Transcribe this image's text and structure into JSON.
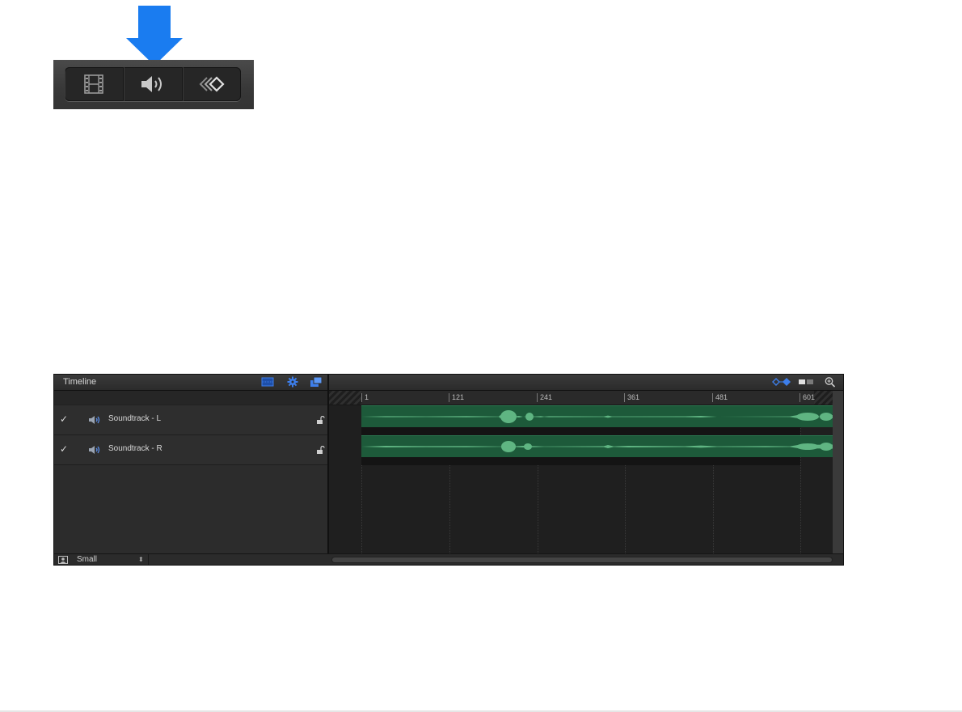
{
  "callout": {
    "arrow_color": "#1a7cf0",
    "segments": [
      {
        "icon": "filmstrip-icon"
      },
      {
        "icon": "speaker-icon"
      },
      {
        "icon": "keyframe-icon"
      }
    ]
  },
  "timeline": {
    "title": "Timeline",
    "header_icons": [
      "grid-view-icon",
      "gear-icon",
      "layers-stack-icon",
      "keyframe-toggle-icon",
      "track-height-icon",
      "zoom-icon"
    ],
    "tracks": [
      {
        "checked": "✓",
        "name": "Soundtrack - L"
      },
      {
        "checked": "✓",
        "name": "Soundtrack - R"
      }
    ],
    "ruler_ticks": [
      "1",
      "121",
      "241",
      "361",
      "481",
      "601"
    ],
    "footer": {
      "size_label": "Small",
      "size_arrows": "⬍"
    },
    "colors": {
      "accent": "#3d7eea",
      "clip": "#1d5a3a",
      "waveform": "#5fb582"
    }
  }
}
